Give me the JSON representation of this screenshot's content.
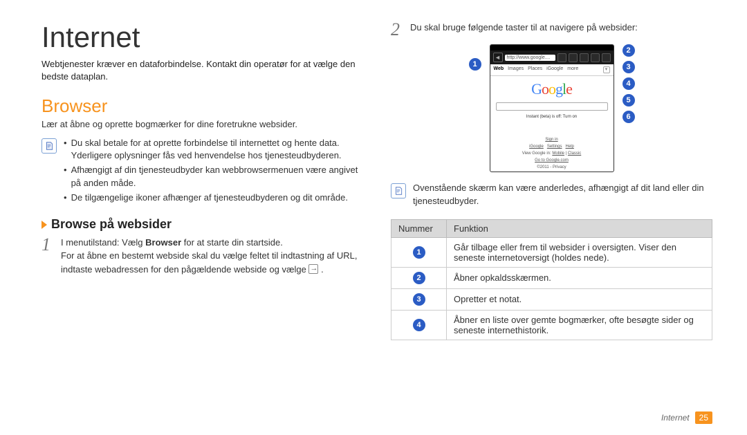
{
  "title": "Internet",
  "intro": "Webtjenester kræver en dataforbindelse. Kontakt din operatør for at vælge den bedste dataplan.",
  "browser": {
    "heading": "Browser",
    "sub": "Lær at åbne og oprette bogmærker for dine foretrukne websider.",
    "notes": [
      "Du skal betale for at oprette forbindelse til internettet og hente data. Yderligere oplysninger fås ved henvendelse hos tjenesteudbyderen.",
      "Afhængigt af din tjenesteudbyder kan webbrowsermenuen være angivet på anden måde.",
      "De tilgængelige ikoner afhænger af tjenesteudbyderen og dit område."
    ],
    "subheading": "Browse på websider",
    "steps": {
      "1": {
        "line1_pre": "I menutilstand: Vælg ",
        "line1_bold": "Browser",
        "line1_post": " for at starte din startside.",
        "line2": "For at åbne en bestemt webside skal du vælge feltet til indtastning af URL, indtaste webadressen for den pågældende webside og vælge "
      },
      "2": {
        "text": "Du skal bruge følgende taster til at navigere på websider:"
      }
    }
  },
  "phone": {
    "url": "http://www.google....",
    "tabs": [
      "Web",
      "Images",
      "Places",
      "iGoogle",
      "more"
    ],
    "instant": "Instant (beta) is off: Turn on",
    "links": {
      "signin": "Sign in",
      "row1": [
        "iGoogle",
        "Settings",
        "Help"
      ],
      "row2_pre": "View Google in: ",
      "row2_links": [
        "Mobile",
        "Classic"
      ],
      "row3": "Go to Google.com",
      "row4": "©2011 - Privacy"
    }
  },
  "right_note": "Ovenstående skærm kan være anderledes, afhængigt af dit land eller din tjenesteudbyder.",
  "table": {
    "headers": [
      "Nummer",
      "Funktion"
    ],
    "rows": [
      {
        "n": "1",
        "f": "Går tilbage eller frem til websider i oversigten. Viser den seneste internetoversigt (holdes nede)."
      },
      {
        "n": "2",
        "f": "Åbner opkaldsskærmen."
      },
      {
        "n": "3",
        "f": "Opretter et notat."
      },
      {
        "n": "4",
        "f": "Åbner en liste over gemte bogmærker, ofte besøgte sider og seneste internethistorik."
      }
    ]
  },
  "footer": {
    "section": "Internet",
    "page": "25"
  }
}
